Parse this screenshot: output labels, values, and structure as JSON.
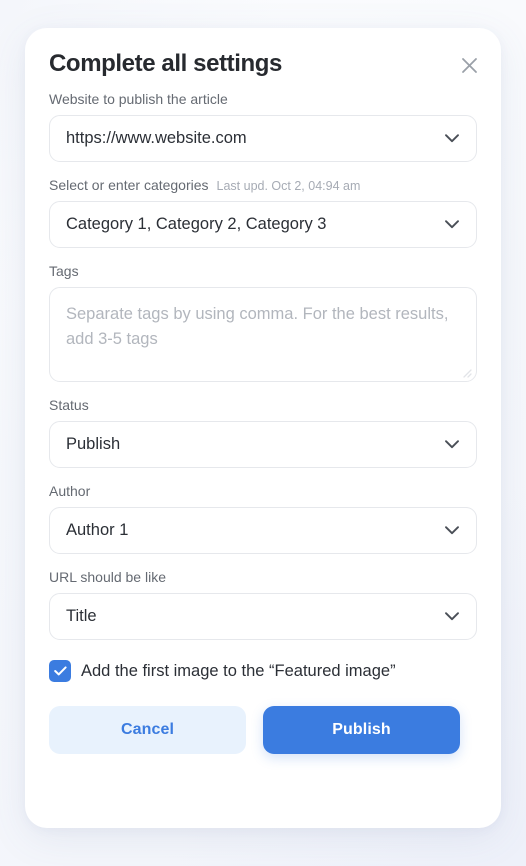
{
  "modal": {
    "title": "Complete all settings",
    "close_icon": "close-icon"
  },
  "fields": {
    "website": {
      "label": "Website to publish the article",
      "value": "https://www.website.com",
      "icon": "chevron-down-icon"
    },
    "categories": {
      "label": "Select or enter categories",
      "meta": "Last upd. Oct 2, 04:94 am",
      "value": "Category 1, Category 2, Category 3",
      "icon": "chevron-down-icon"
    },
    "tags": {
      "label": "Tags",
      "value": "",
      "placeholder": "Separate tags by using comma. For the best results, add 3-5 tags",
      "resize_handle": "resize-handle-icon"
    },
    "status": {
      "label": "Status",
      "value": "Publish",
      "icon": "chevron-down-icon"
    },
    "author": {
      "label": "Author",
      "value": "Author 1",
      "icon": "chevron-down-icon"
    },
    "url_format": {
      "label": "URL should be like",
      "value": "Title",
      "icon": "chevron-down-icon"
    }
  },
  "featured_image_checkbox": {
    "label": "Add the first image to the “Featured image”",
    "checked": true,
    "icon": "check-icon"
  },
  "actions": {
    "cancel_label": "Cancel",
    "publish_label": "Publish"
  },
  "colors": {
    "accent": "#3b7ce0",
    "accent_soft": "#e8f2fd",
    "label_text": "#656a72",
    "meta_text": "#a6abb4",
    "value_text": "#2b2f36",
    "placeholder_text": "#b2b6bd",
    "border": "#e6e8ec",
    "card_bg": "#ffffff"
  }
}
